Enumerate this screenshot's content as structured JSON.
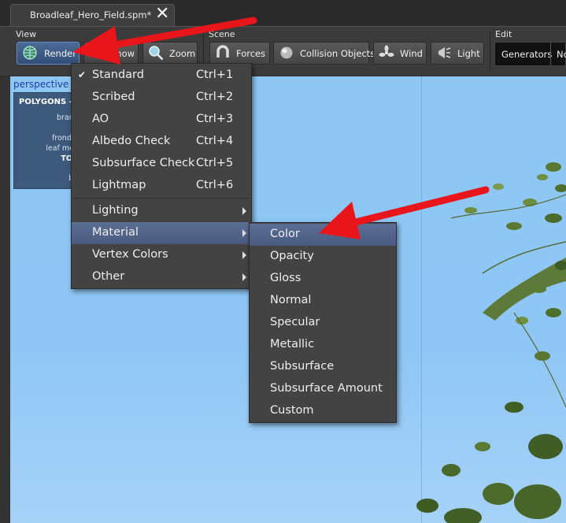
{
  "tab": {
    "title": "Broadleaf_Hero_Field.spm*",
    "close_icon": "close-icon"
  },
  "toolbar": {
    "groups": {
      "view": "View",
      "scene": "Scene",
      "edit": "Edit"
    },
    "buttons": {
      "render": "Render",
      "show": "Show",
      "zoom": "Zoom",
      "forces": "Forces",
      "collision": "Collision Objects",
      "wind": "Wind",
      "light": "Light",
      "generators": "Generators",
      "next": "No"
    }
  },
  "viewport": {
    "label": "perspective",
    "stats": {
      "title": "POLYGONS -",
      "lines": [
        "branch",
        "ca",
        "fronds/fl",
        "leaf mesh",
        "TOTA",
        "bon"
      ]
    }
  },
  "render_menu": {
    "items": [
      {
        "label": "Standard",
        "shortcut": "Ctrl+1",
        "checked": true
      },
      {
        "label": "Scribed",
        "shortcut": "Ctrl+2"
      },
      {
        "label": "AO",
        "shortcut": "Ctrl+3"
      },
      {
        "label": "Albedo Check",
        "shortcut": "Ctrl+4"
      },
      {
        "label": "Subsurface Check",
        "shortcut": "Ctrl+5"
      },
      {
        "label": "Lightmap",
        "shortcut": "Ctrl+6"
      }
    ],
    "submenus": [
      {
        "label": "Lighting"
      },
      {
        "label": "Material"
      },
      {
        "label": "Vertex Colors"
      },
      {
        "label": "Other"
      }
    ]
  },
  "material_menu": {
    "items": [
      "Color",
      "Opacity",
      "Gloss",
      "Normal",
      "Specular",
      "Metallic",
      "Subsurface",
      "Subsurface Amount",
      "Custom"
    ]
  },
  "colors": {
    "accent": "#5b6e94",
    "annotation": "#e8161b",
    "sky": "#8ec6f4"
  }
}
